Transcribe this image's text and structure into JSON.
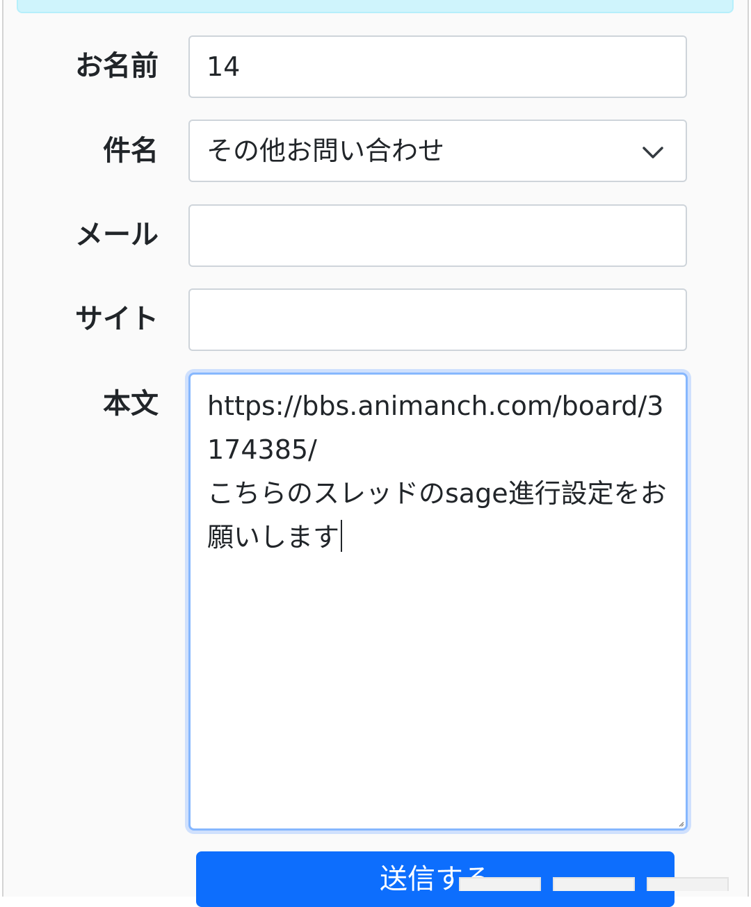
{
  "form": {
    "name": {
      "label": "お名前",
      "value": "14"
    },
    "subject": {
      "label": "件名",
      "value": "その他お問い合わせ"
    },
    "email": {
      "label": "メール",
      "value": ""
    },
    "site": {
      "label": "サイト",
      "value": ""
    },
    "body": {
      "label": "本文",
      "value": "https://bbs.animanch.com/board/3174385/\nこちらのスレッドのsage進行設定をお願いします"
    },
    "submit_label": "送信する"
  },
  "colors": {
    "primary": "#0d6efd",
    "focus_border": "#86b7fe",
    "info_bar": "#cff4fc"
  },
  "icons": {
    "select_arrow": "chevron-down-icon"
  }
}
